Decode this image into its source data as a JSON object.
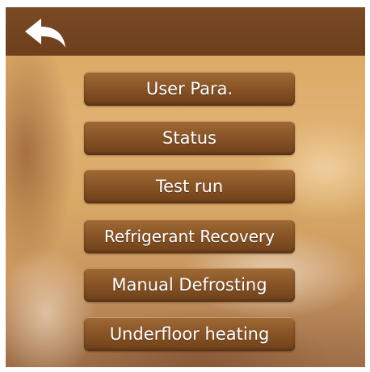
{
  "header": {
    "back_icon": "back-arrow-icon"
  },
  "menu": {
    "items": [
      {
        "label": "User Para."
      },
      {
        "label": "Status"
      },
      {
        "label": "Test run"
      },
      {
        "label": "Refrigerant Recovery"
      },
      {
        "label": "Manual Defrosting"
      },
      {
        "label": "Underfloor heating"
      }
    ]
  },
  "colors": {
    "topbar": "#6d3f1d",
    "button": "#8a5527",
    "text": "#ffffff"
  }
}
